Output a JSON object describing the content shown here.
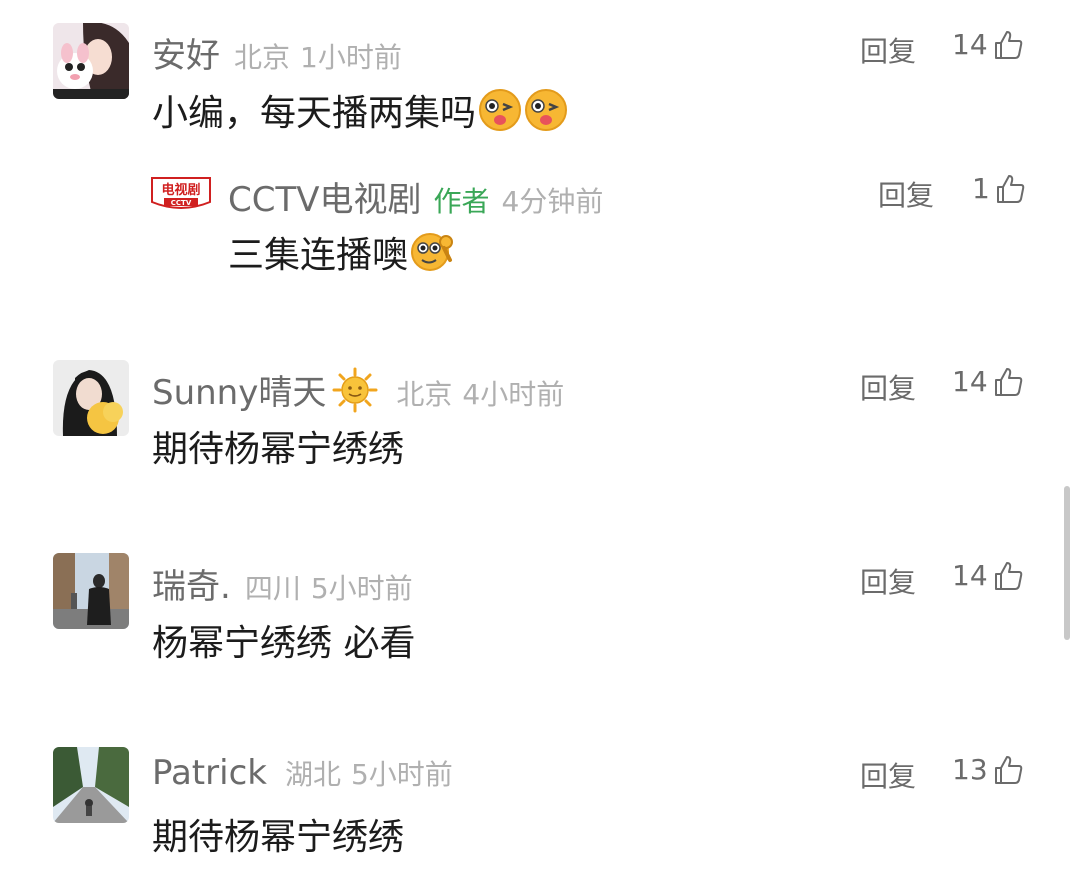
{
  "comments": [
    {
      "username": "安好",
      "location": "北京",
      "time": "1小时前",
      "text": "小编，每天播两集吗",
      "emojis": [
        "wink-tongue-emoji",
        "wink-tongue-emoji"
      ],
      "reply_label": "回复",
      "likes": "14",
      "replies": [
        {
          "username": "CCTV电视剧",
          "tag": "作者",
          "time": "4分钟前",
          "text": "三集连播噢",
          "emojis": [
            "ok-hand-face-emoji"
          ],
          "reply_label": "回复",
          "likes": "1",
          "avatar_text_top": "电视剧",
          "avatar_text_bottom": "CCTV"
        }
      ]
    },
    {
      "username": "Sunny晴天",
      "username_emoji": "sun-emoji",
      "location": "北京",
      "time": "4小时前",
      "text": "期待杨幂宁绣绣",
      "reply_label": "回复",
      "likes": "14"
    },
    {
      "username": "瑞奇.",
      "location": "四川",
      "time": "5小时前",
      "text": "杨幂宁绣绣 必看",
      "reply_label": "回复",
      "likes": "14"
    },
    {
      "username": "Patrick",
      "location": "湖北",
      "time": "5小时前",
      "text": "期待杨幂宁绣绣",
      "reply_label": "回复",
      "likes": "13"
    }
  ],
  "colors": {
    "author_tag": "#3aa757",
    "username": "#6b6b6b",
    "meta": "#b0b0b0",
    "content": "#1c1c1c"
  }
}
